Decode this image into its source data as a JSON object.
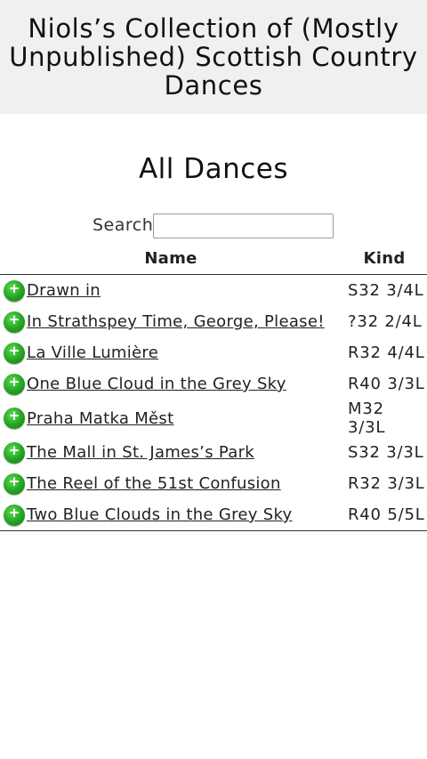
{
  "site": {
    "title": "Niols’s Collection of (Mostly Unpublished) Scottish Country Dances"
  },
  "page": {
    "title": "All Dances"
  },
  "search": {
    "label": "Search:",
    "value": ""
  },
  "table": {
    "headers": {
      "name": "Name",
      "kind": "Kind"
    },
    "expand_symbol": "+",
    "rows": [
      {
        "name": "Drawn in",
        "kind": "S32 3/4L"
      },
      {
        "name": "In Strathspey Time, George, Please!",
        "kind": "?32 2/4L"
      },
      {
        "name": "La Ville Lumière",
        "kind": "R32 4/4L"
      },
      {
        "name": "One Blue Cloud in the Grey Sky",
        "kind": "R40 3/3L"
      },
      {
        "name": "Praha Matka Měst",
        "kind": "M32 3/3L"
      },
      {
        "name": "The Mall in St. James’s Park",
        "kind": "S32 3/3L"
      },
      {
        "name": "The Reel of the 51st Confusion",
        "kind": "R32 3/3L"
      },
      {
        "name": "Two Blue Clouds in the Grey Sky",
        "kind": "R40 5/5L"
      }
    ]
  },
  "colors": {
    "header_bg": "#f0f0f0",
    "expand_button": "#22a31f"
  }
}
